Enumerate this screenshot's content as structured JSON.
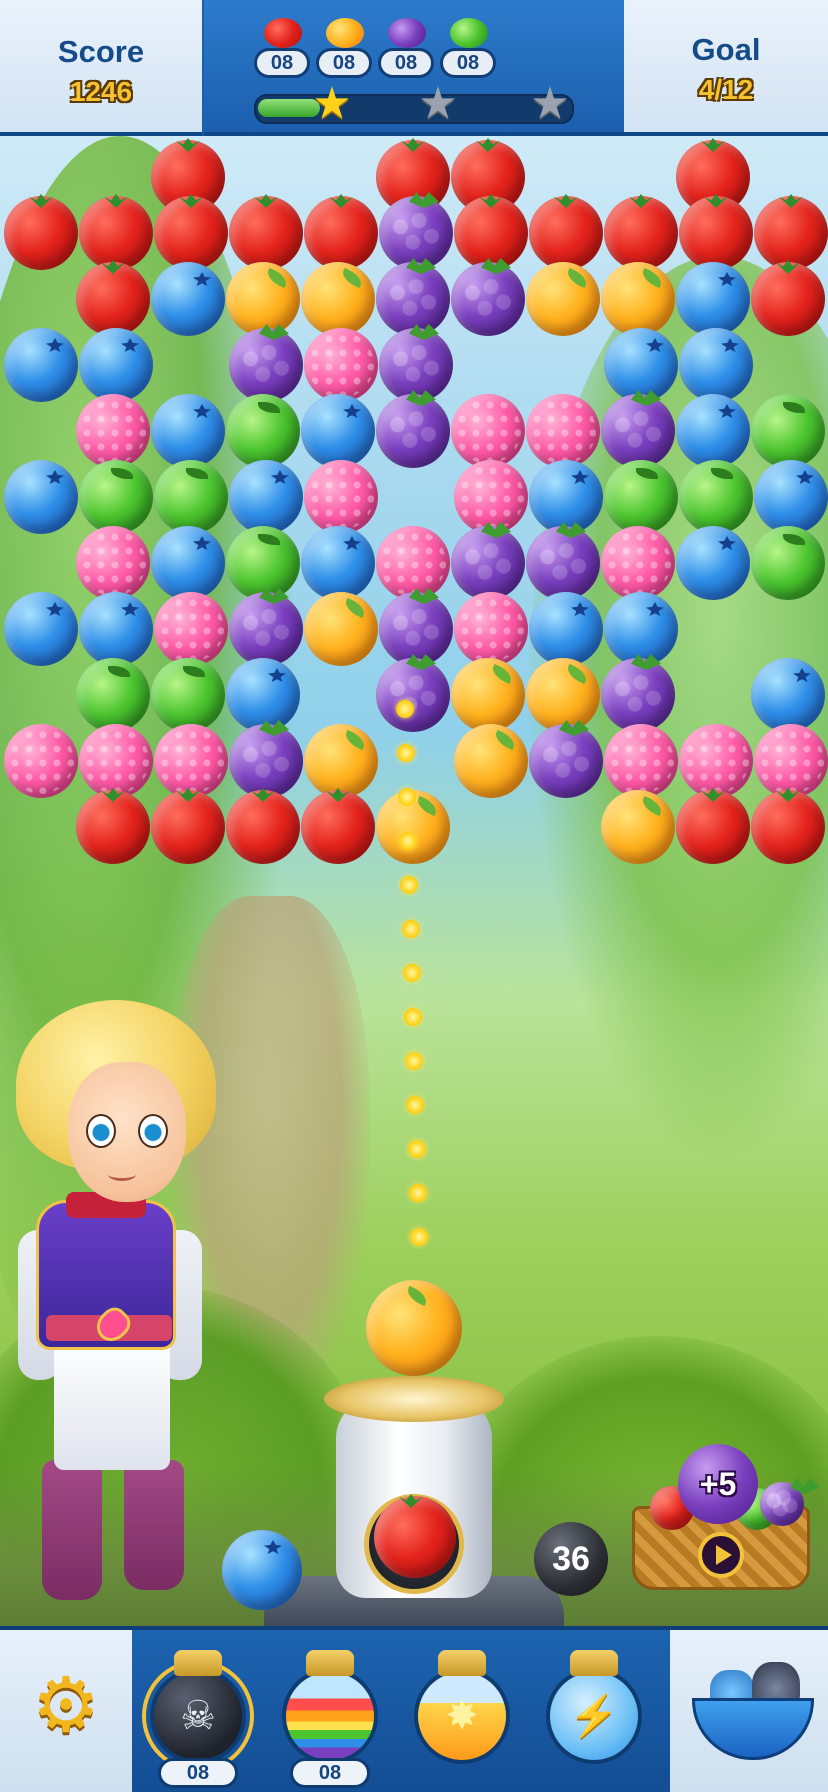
{
  "header": {
    "score_label": "Score",
    "score_value": "1246",
    "goal_label": "Goal",
    "goal_value": "4/12",
    "targets": [
      {
        "fruit": "tomato",
        "count": "08"
      },
      {
        "fruit": "orange",
        "count": "08"
      },
      {
        "fruit": "grape",
        "count": "08"
      },
      {
        "fruit": "apple",
        "count": "08"
      }
    ],
    "progress_fraction": 0.2,
    "stars_earned": 1,
    "stars_total": 3
  },
  "board": {
    "current_bubble": "orange",
    "next_bubble": "tomato",
    "swap_bubble": "blueberry",
    "moves_left": "36"
  },
  "basket": {
    "bonus_label": "+5"
  },
  "boosters": [
    {
      "name": "bomb",
      "count": "08",
      "icon": "skull-icon"
    },
    {
      "name": "rainbow",
      "count": "08",
      "icon": "rainbow-icon"
    },
    {
      "name": "fire",
      "count": "",
      "icon": "fire-icon"
    },
    {
      "name": "lightning",
      "count": "",
      "icon": "lightning-icon"
    }
  ],
  "colors": {
    "tomato": "#e3231c",
    "orange": "#ffb21e",
    "blueberry": "#2f8fe8",
    "apple": "#4cc52f",
    "grape": "#7a3fbe",
    "raspberry": "#ff5ba7",
    "bar_blue": "#1d5fa8",
    "gold": "#f7c230"
  }
}
